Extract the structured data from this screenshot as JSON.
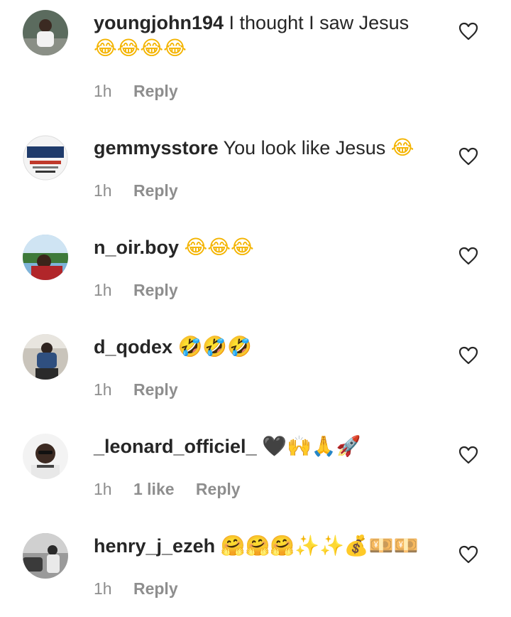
{
  "comments": [
    {
      "username": "youngjohn194",
      "text": "I thought I saw Jesus",
      "emojis_line2": "😂😂😂😂",
      "time": "1h",
      "reply": "Reply"
    },
    {
      "username": "gemmysstore",
      "text": "You look like Jesus",
      "emojis": "😂",
      "avatar_text": "Gemmy's",
      "time": "1h",
      "reply": "Reply"
    },
    {
      "username": "n_oir.boy",
      "emojis": "😂😂😂",
      "time": "1h",
      "reply": "Reply"
    },
    {
      "username": "d_qodex",
      "emojis": "🤣🤣🤣",
      "time": "1h",
      "reply": "Reply"
    },
    {
      "username": "_leonard_officiel_",
      "emojis": "🖤🙌🙏🚀",
      "time": "1h",
      "likes": "1 like",
      "reply": "Reply"
    },
    {
      "username": "henry_j_ezeh",
      "emojis": "🤗🤗🤗✨✨💰💴💴",
      "time": "1h",
      "reply": "Reply"
    }
  ],
  "icons": {
    "like": "heart-outline-icon"
  },
  "colors": {
    "text": "#262626",
    "meta": "#8e8e8e",
    "emoji": "#f4b400"
  }
}
